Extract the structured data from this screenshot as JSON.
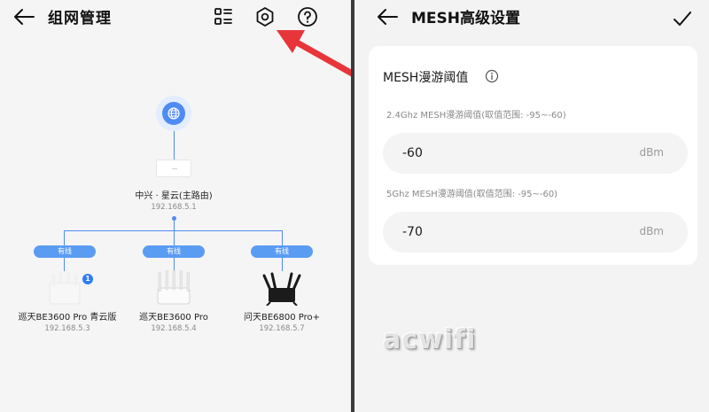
{
  "left": {
    "title": "组网管理",
    "icons": [
      "back-arrow-icon",
      "device-list-icon",
      "settings-hex-icon",
      "help-circle-icon"
    ],
    "main_node": {
      "name": "中兴 · 星云(主路由)",
      "ip": "192.168.5.1"
    },
    "link_label": "有线",
    "children": [
      {
        "name": "巡天BE3600 Pro 青云版",
        "ip": "192.168.5.3",
        "badge": "1"
      },
      {
        "name": "巡天BE3600 Pro",
        "ip": "192.168.5.4"
      },
      {
        "name": "问天BE6800 Pro+",
        "ip": "192.168.5.7"
      }
    ]
  },
  "right": {
    "title": "MESH高级设置",
    "section_title": "MESH漫游阈值",
    "fields": [
      {
        "label": "2.4Ghz MESH漫游阈值(取值范围: -95~-60)",
        "value": "-60",
        "unit": "dBm"
      },
      {
        "label": "5Ghz MESH漫游阈值(取值范围: -95~-60)",
        "value": "-70",
        "unit": "dBm"
      }
    ],
    "watermark": "acwifi"
  },
  "colors": {
    "accent": "#4f8bf5",
    "tag": "#5b9cf3",
    "badge": "#2f7cf6",
    "arrow": "#e8353a"
  }
}
